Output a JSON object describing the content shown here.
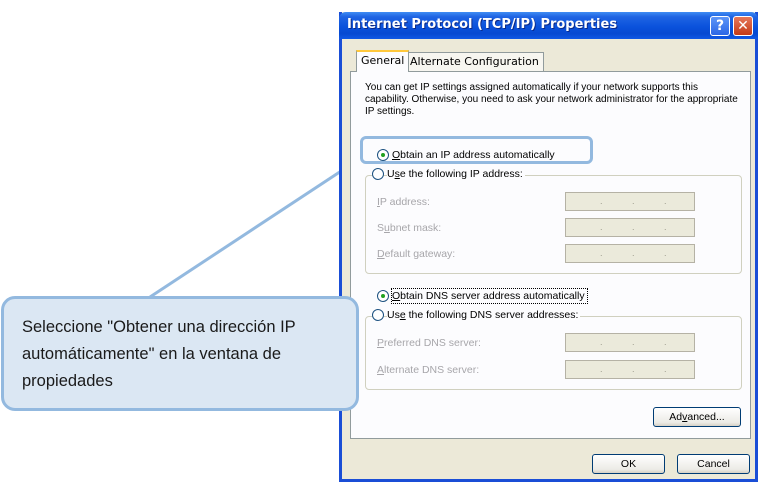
{
  "window": {
    "title": "Internet Protocol (TCP/IP) Properties",
    "help_glyph": "?",
    "close_glyph": "✕"
  },
  "tabs": [
    {
      "label": "General",
      "active": true
    },
    {
      "label": "Alternate Configuration",
      "active": false
    }
  ],
  "description": "You can get IP settings assigned automatically if your network supports this capability. Otherwise, you need to ask your network administrator for the appropriate IP settings.",
  "ip_section": {
    "auto": {
      "mn": "O",
      "rest": "btain an IP address automatically",
      "checked": true
    },
    "manual": {
      "pre": "U",
      "mn": "s",
      "rest": "e the following IP address:",
      "checked": false
    },
    "fields": [
      {
        "mn": "I",
        "rest": "P address:"
      },
      {
        "pre": "S",
        "mn": "u",
        "rest": "bnet mask:"
      },
      {
        "mn": "D",
        "rest": "efault gateway:"
      }
    ]
  },
  "dns_section": {
    "auto": {
      "mn": "O",
      "rest": "btain DNS server address automatically",
      "checked": true
    },
    "manual": {
      "pre": "Us",
      "mn": "e",
      "rest": " the following DNS server addresses:",
      "checked": false
    },
    "fields": [
      {
        "mn": "P",
        "rest": "referred DNS server:"
      },
      {
        "mn": "A",
        "rest": "lternate DNS server:"
      }
    ]
  },
  "ip_dot": ".",
  "buttons": {
    "advanced": {
      "pre": "Ad",
      "mn": "v",
      "rest": "anced..."
    },
    "ok": "OK",
    "cancel": "Cancel"
  },
  "callout": {
    "text": "Seleccione \"Obtener una dirección IP automáticamente\" en la ventana de propiedades"
  },
  "colors": {
    "titlebar": "#0a52dc",
    "callout_fill": "#dbe7f3",
    "callout_border": "#93b9df",
    "radio_dot": "#21a121"
  }
}
